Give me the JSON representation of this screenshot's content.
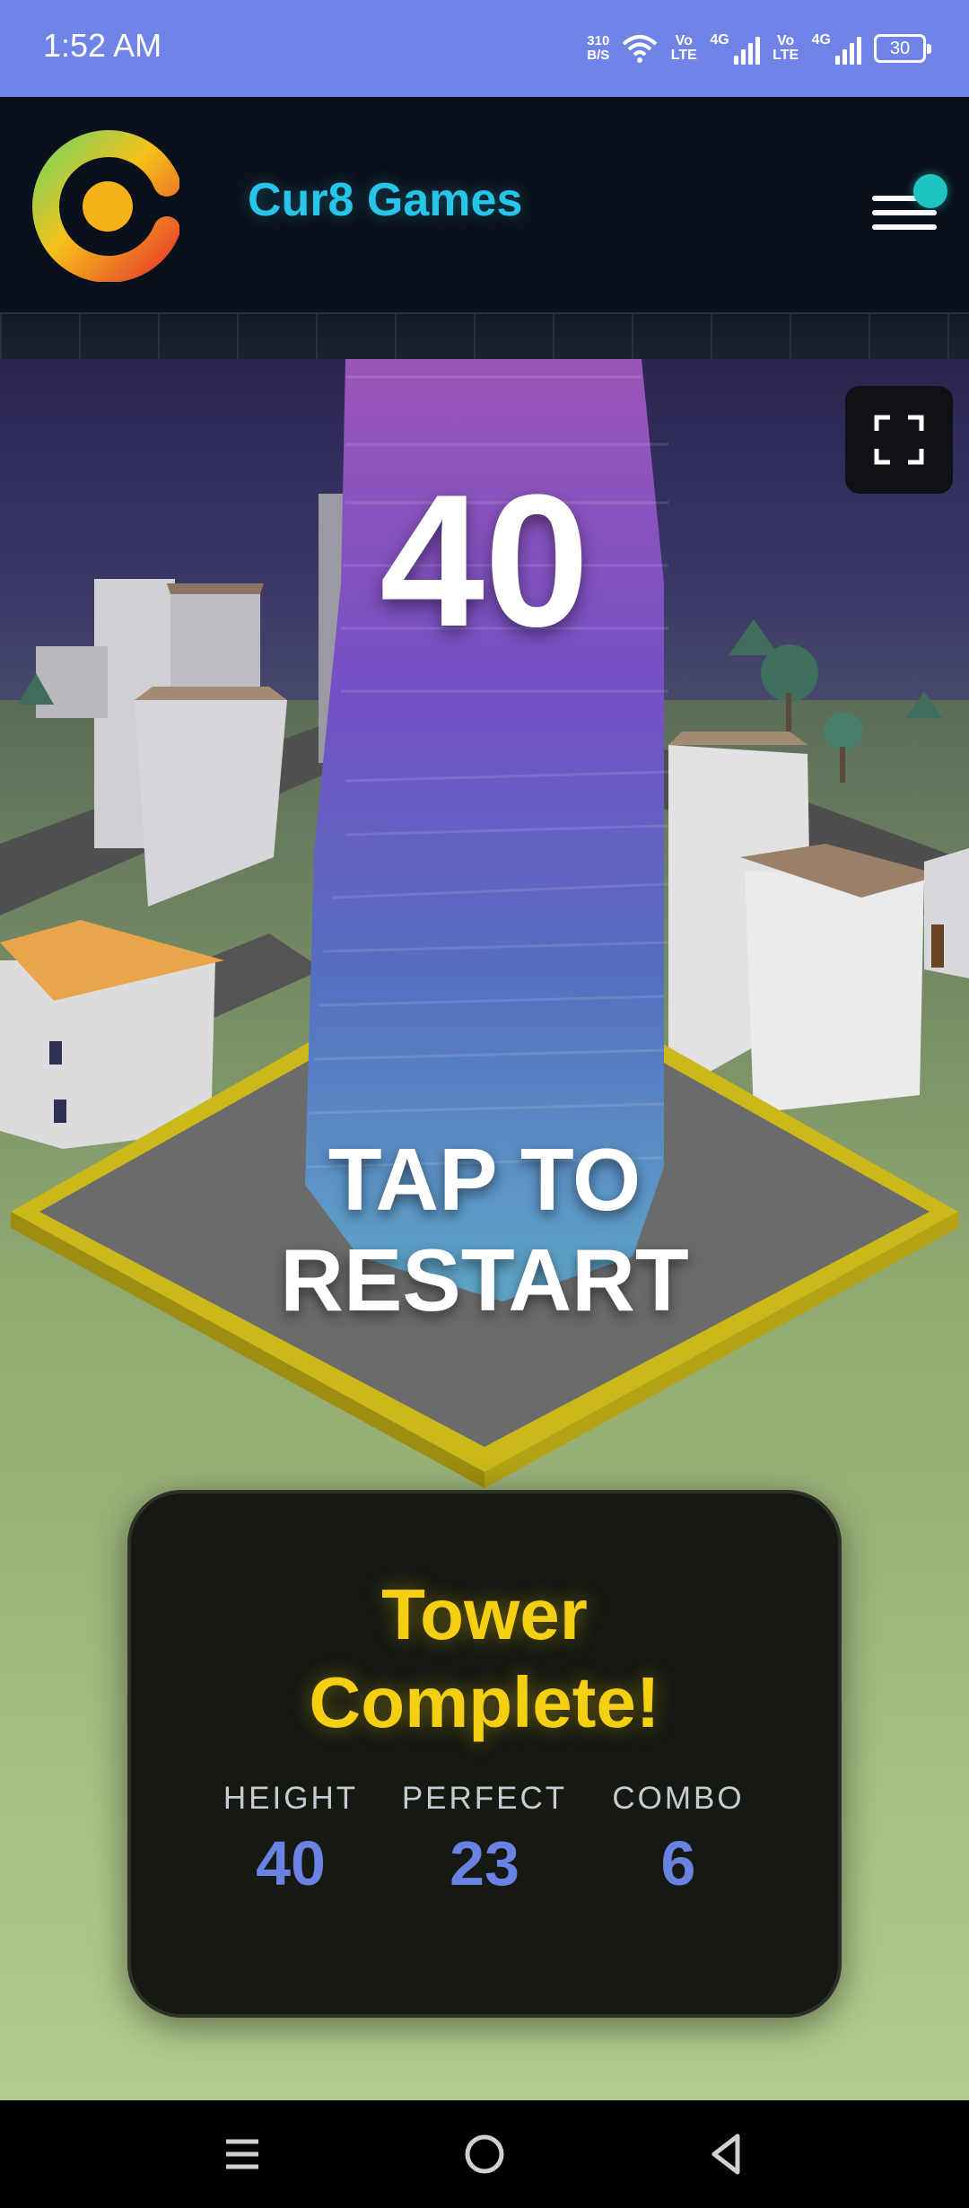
{
  "status_bar": {
    "time": "1:52 AM",
    "net_speed_value": "310",
    "net_speed_unit": "B/S",
    "volte_1": "Vo LTE",
    "network_1": "4G",
    "volte_2": "Vo LTE",
    "network_2": "4G",
    "battery": "30"
  },
  "header": {
    "brand": "Cur8 Games",
    "accent_color": "#27c6e8",
    "logo_icon": "cur8-logo-icon",
    "menu_icon": "hamburger-menu-icon"
  },
  "game": {
    "score": "40",
    "restart_line1": "TAP TO",
    "restart_line2": "RESTART",
    "fullscreen_icon": "fullscreen-icon"
  },
  "result_card": {
    "title_line1": "Tower",
    "title_line2": "Complete!",
    "title_color": "#f5cf12",
    "value_color": "#6a83e3",
    "stats": [
      {
        "label": "HEIGHT",
        "value": "40"
      },
      {
        "label": "PERFECT",
        "value": "23"
      },
      {
        "label": "COMBO",
        "value": "6"
      }
    ]
  },
  "nav_bar": {
    "recent_icon": "recent-apps-icon",
    "home_icon": "home-icon",
    "back_icon": "back-icon"
  }
}
